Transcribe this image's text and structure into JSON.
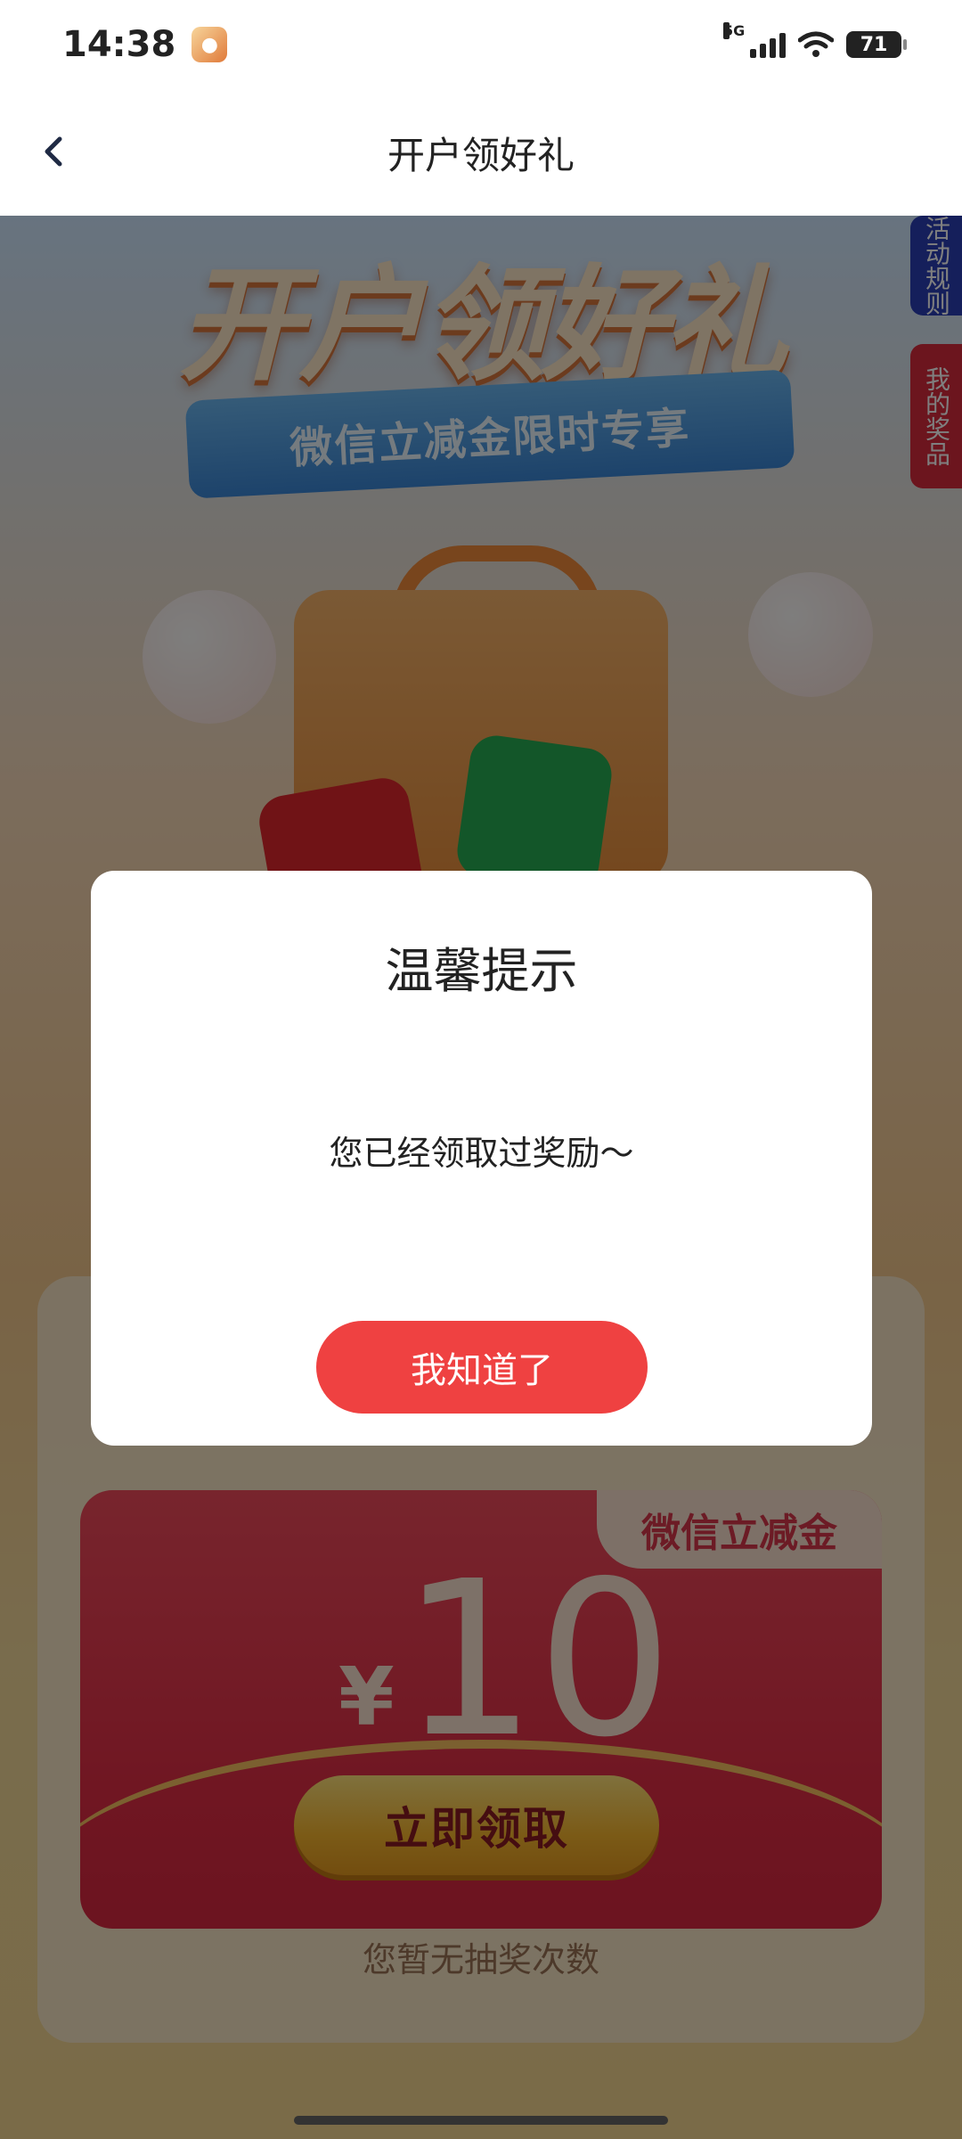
{
  "status_bar": {
    "time": "14:38",
    "network": "5G",
    "battery": "71"
  },
  "nav": {
    "title": "开户领好礼"
  },
  "promo": {
    "headline": "开户领好礼",
    "subtitle": "微信立减金限时专享",
    "side_tabs": {
      "rules": "活动规则",
      "prizes": "我的奖品"
    }
  },
  "reward_card": {
    "badge": "微信立减金",
    "currency": "¥",
    "amount": "10",
    "claim_label": "立即领取",
    "chances_text": "您暂无抽奖次数"
  },
  "dialog": {
    "title": "温馨提示",
    "message": "您已经领取过奖励～",
    "button_label": "我知道了"
  },
  "colors": {
    "primary_red": "#ef4141",
    "side_tab_blue": "#2b3fb7",
    "side_tab_red": "#d92b3d",
    "packet_red": "#e02c44",
    "claim_gold": "#f6b52d"
  }
}
